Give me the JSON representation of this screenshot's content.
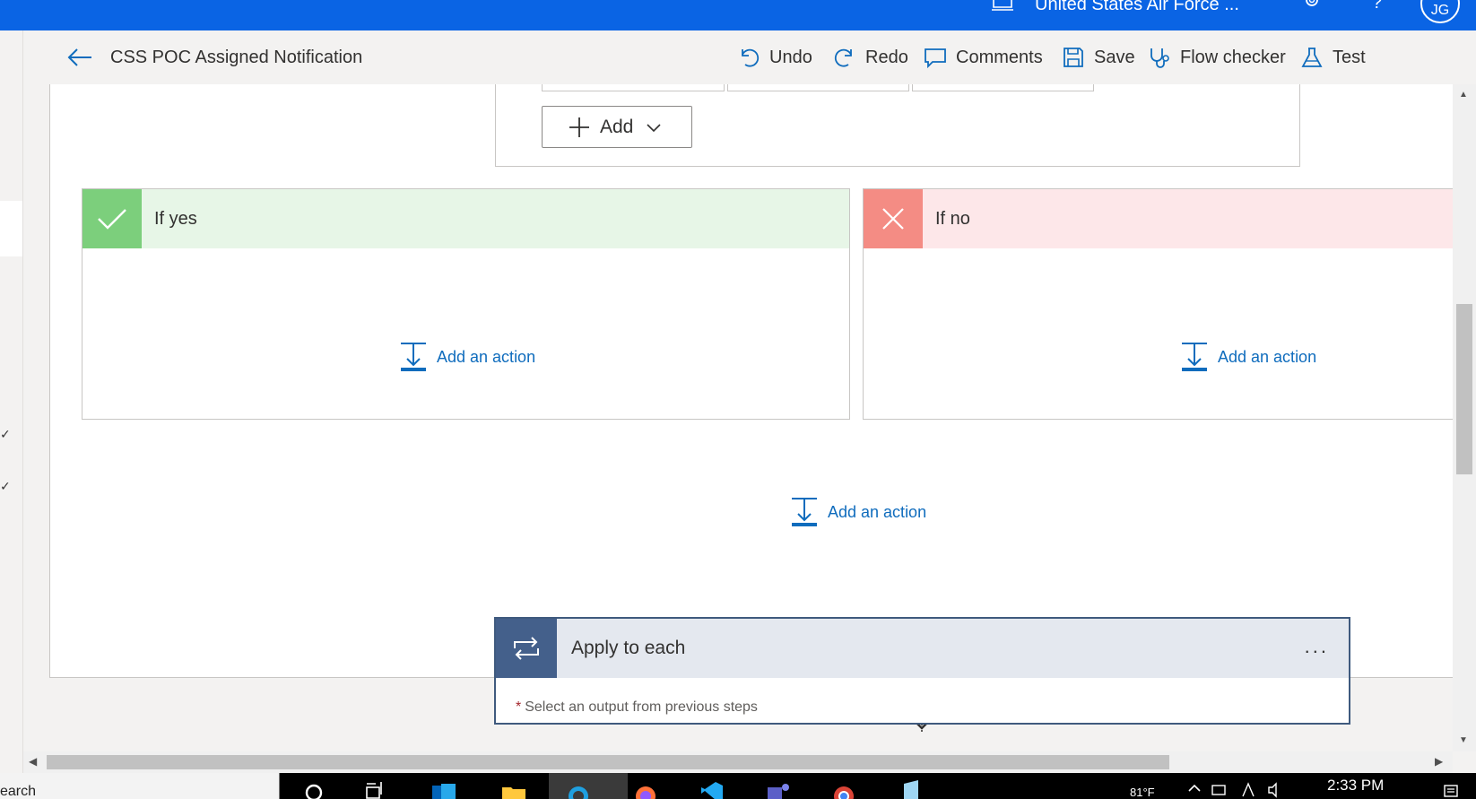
{
  "topbar": {
    "environment": "United States Air Force ...",
    "avatar_initials": "JG",
    "help": "?"
  },
  "cmdbar": {
    "flow_title": "CSS POC Assigned Notification",
    "undo": "Undo",
    "redo": "Redo",
    "comments": "Comments",
    "save": "Save",
    "flow_checker": "Flow checker",
    "test": "Test"
  },
  "condition": {
    "add_label": "Add",
    "if_yes": "If yes",
    "if_no": "If no",
    "add_action_yes": "Add an action",
    "add_action_no": "Add an action",
    "add_action_main": "Add an action"
  },
  "apply_each": {
    "title": "Apply to each",
    "more": "...",
    "required_star": "*",
    "required_label": "Select an output from previous steps"
  },
  "taskbar": {
    "search_text": "earch",
    "temperature": "81°F",
    "time": "2:33 PM"
  },
  "colors": {
    "topbar": "#0a64e4",
    "yes_accent": "#7ccf7c",
    "yes_header": "#e7f6e7",
    "no_accent": "#f48c84",
    "no_header": "#fde7e9",
    "link": "#0f6cbd",
    "apply_icon": "#44608b"
  }
}
